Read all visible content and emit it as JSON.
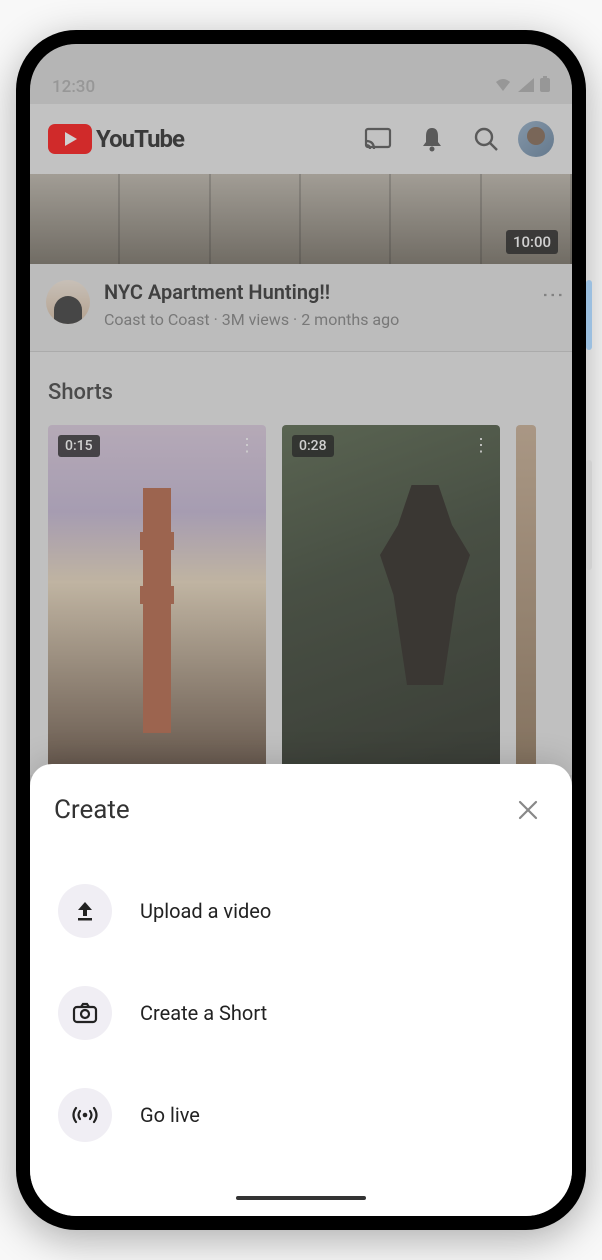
{
  "status": {
    "time": "12:30"
  },
  "appbar": {
    "brand": "YouTube"
  },
  "feed": {
    "video": {
      "duration": "10:00",
      "title": "NYC Apartment Hunting!!",
      "channel": "Coast to Coast",
      "views": "3M views",
      "age": "2 months ago"
    }
  },
  "shorts": {
    "heading": "Shorts",
    "items": [
      {
        "duration": "0:15"
      },
      {
        "duration": "0:28"
      }
    ]
  },
  "sheet": {
    "title": "Create",
    "options": {
      "upload": "Upload a video",
      "short": "Create a Short",
      "live": "Go live"
    }
  }
}
